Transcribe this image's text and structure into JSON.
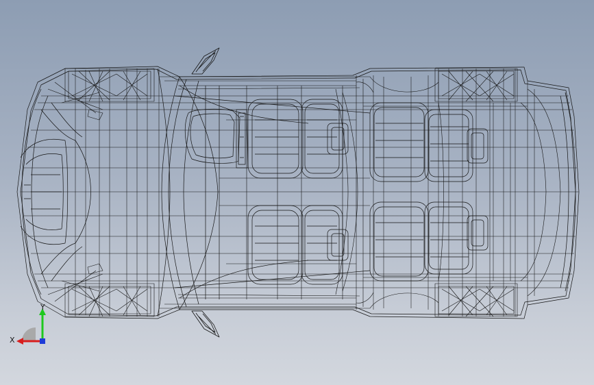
{
  "viewport": {
    "background_top": "#8d9db3",
    "background_bottom": "#d3d7de",
    "wire_color": "#141414",
    "model": "car-wireframe-top-view"
  },
  "triad": {
    "x_label": "X",
    "y_label": "Y",
    "x_color": "#d81e1e",
    "y_color": "#1ec81e",
    "z_color": "#1e3cd8"
  }
}
